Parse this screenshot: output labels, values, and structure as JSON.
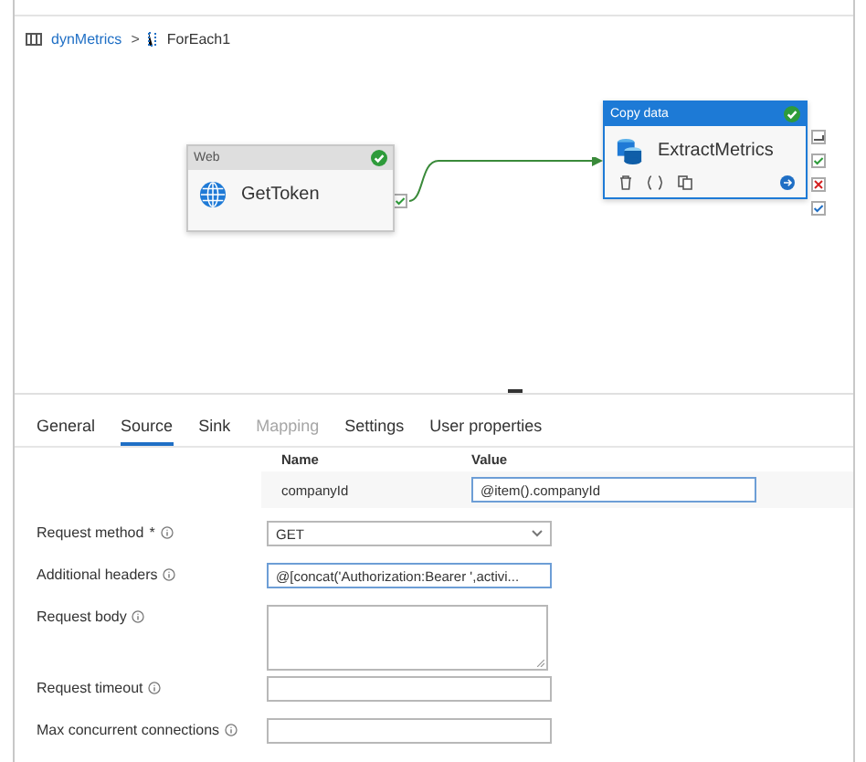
{
  "breadcrumb": [
    {
      "label": "dynMetrics",
      "kind": "pipeline",
      "link": true
    },
    {
      "separator": ">",
      "label": "ForEach1",
      "kind": "foreach",
      "link": false
    }
  ],
  "activities": [
    {
      "type": "Web",
      "name": "GetToken",
      "kind": "web",
      "succeeded": true,
      "selected": false
    },
    {
      "type": "Copy data",
      "name": "ExtractMetrics",
      "kind": "copy",
      "succeeded": true,
      "selected": true
    }
  ],
  "tabs": [
    {
      "label": "General",
      "selected": false,
      "disabled": false
    },
    {
      "label": "Source",
      "selected": true,
      "disabled": false
    },
    {
      "label": "Sink",
      "selected": false,
      "disabled": false
    },
    {
      "label": "Mapping",
      "selected": false,
      "disabled": true
    },
    {
      "label": "Settings",
      "selected": false,
      "disabled": false
    },
    {
      "label": "User properties",
      "selected": false,
      "disabled": false
    }
  ],
  "parameters": {
    "columns": [
      "Name",
      "Value"
    ],
    "rows": [
      {
        "name": "companyId",
        "value": "@item().companyId"
      }
    ]
  },
  "fields": [
    {
      "label": "Request method",
      "required_mark": "*",
      "kind": "select",
      "value": "GET"
    },
    {
      "label": "Additional headers",
      "kind": "input",
      "value": "@[concat('Authorization:Bearer ',activi..."
    },
    {
      "label": "Request body",
      "kind": "textarea"
    },
    {
      "label": "Request timeout",
      "kind": "input"
    },
    {
      "label": "Max concurrent connections",
      "kind": "input"
    }
  ]
}
